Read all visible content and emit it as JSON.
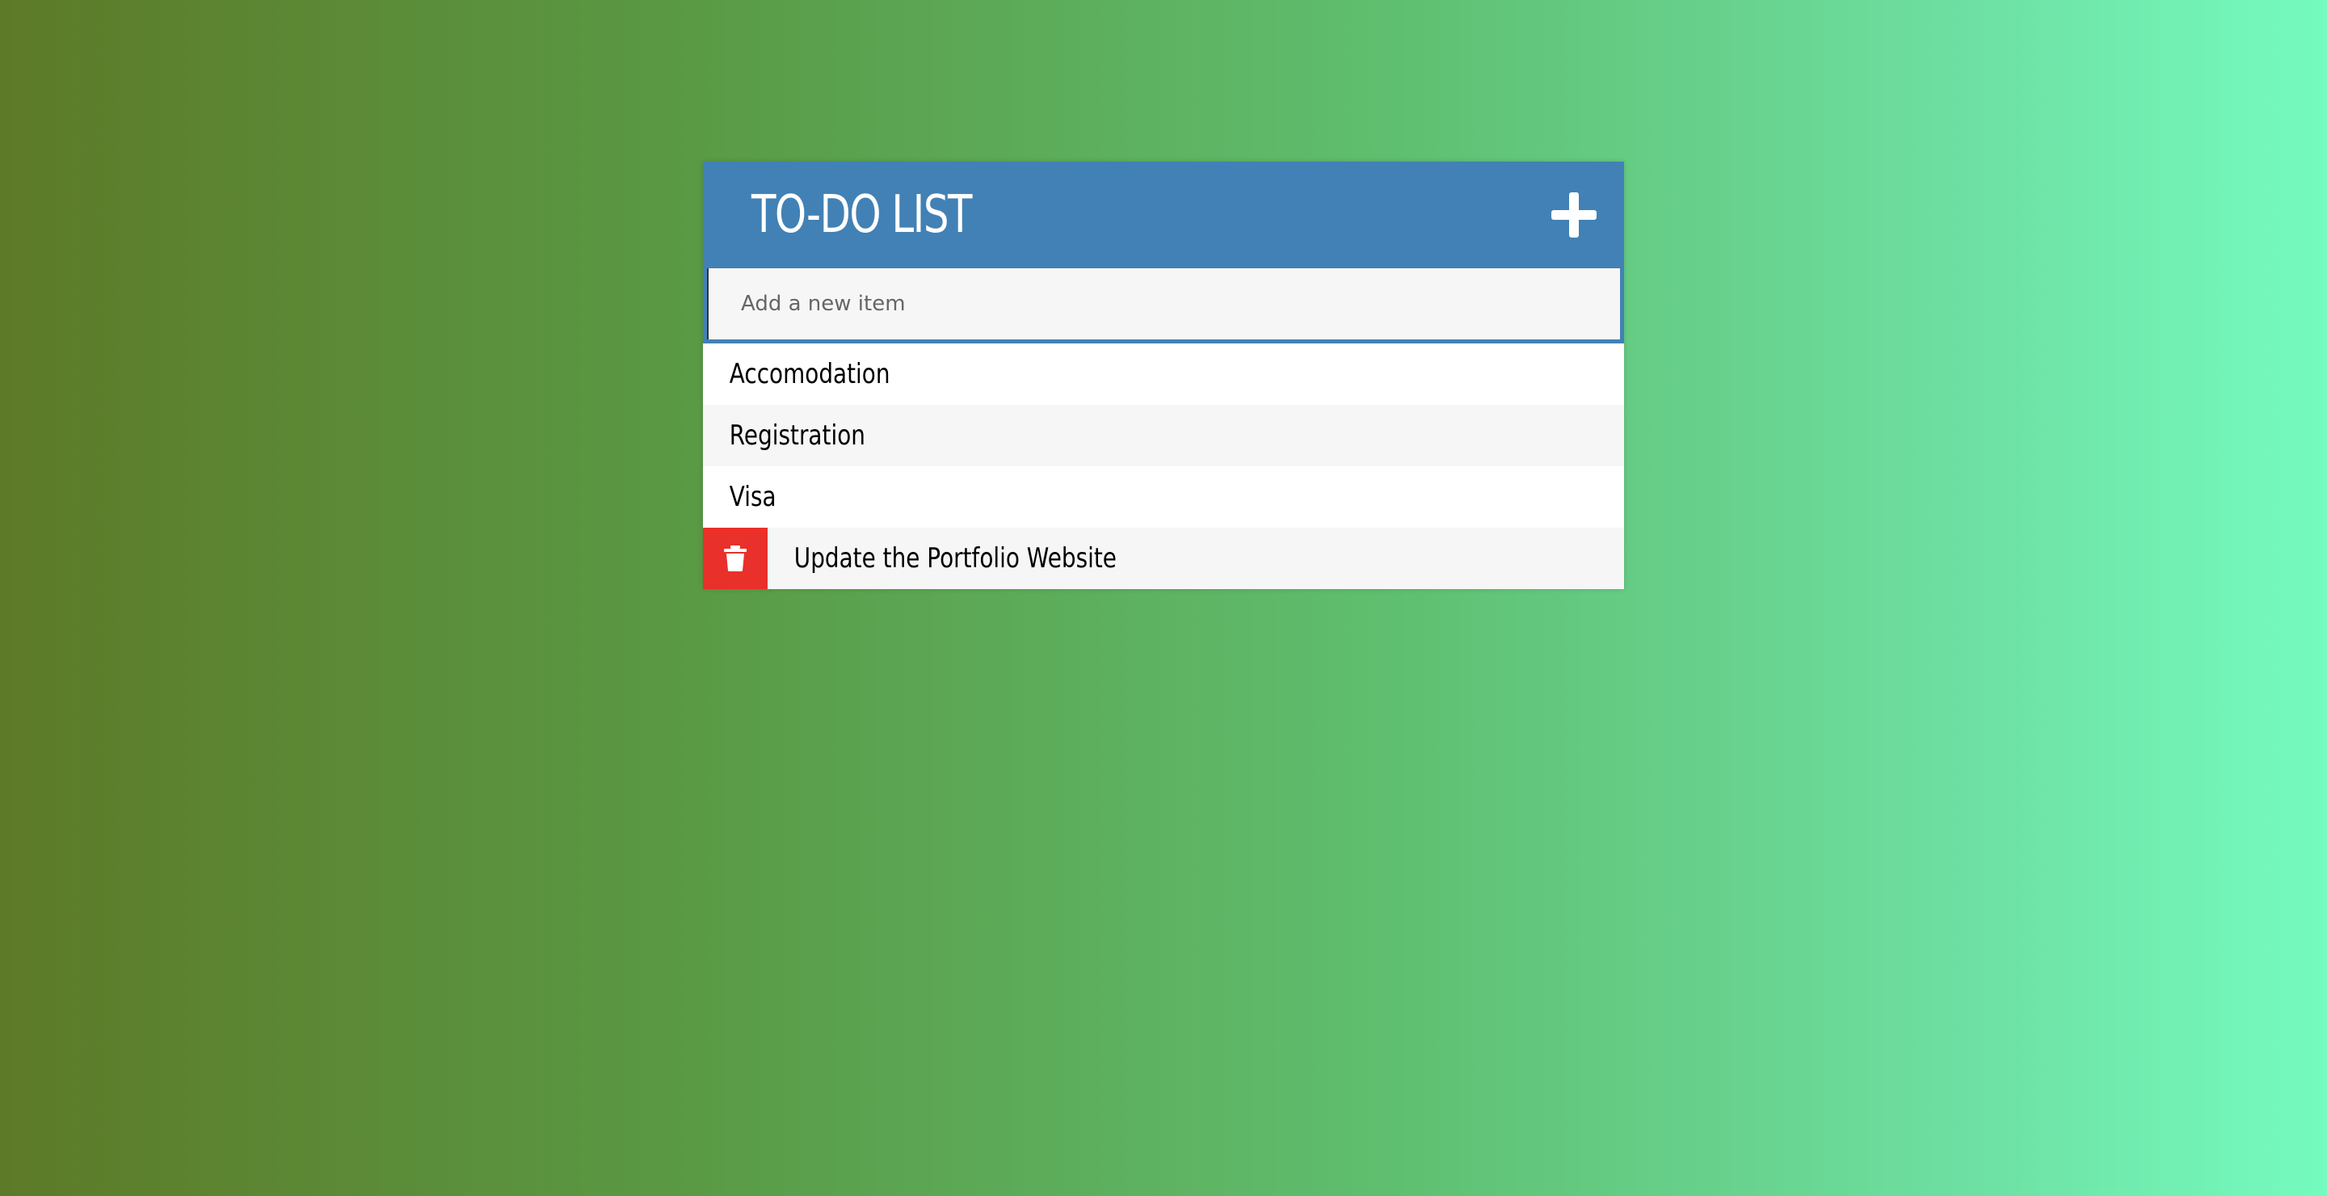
{
  "header": {
    "title": "TO-DO LIST",
    "add_icon": "plus-icon"
  },
  "new_item": {
    "placeholder": "Add a new item",
    "value": ""
  },
  "items": [
    {
      "label": "Accomodation"
    },
    {
      "label": "Registration"
    },
    {
      "label": "Visa"
    },
    {
      "label": "Update the Portfolio Website",
      "delete_icon": "trash-icon"
    }
  ],
  "colors": {
    "header": "#4281b5",
    "delete": "#e9302a",
    "row_alt": "#f6f6f6"
  }
}
